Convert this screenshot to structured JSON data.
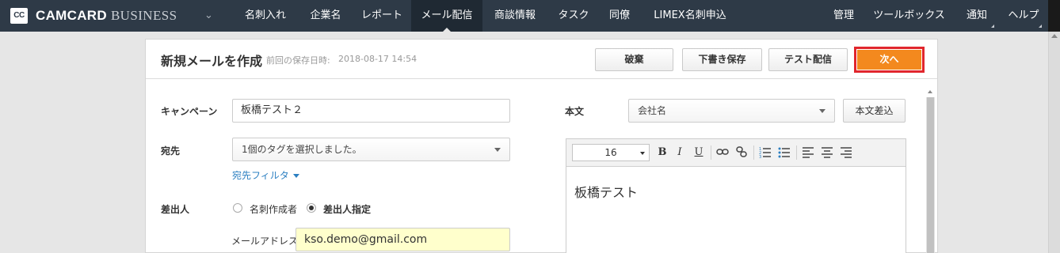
{
  "nav": {
    "logo": "CC",
    "brand": "CAMCARD",
    "brand_sub": "BUSINESS",
    "items": [
      {
        "label": "名刺入れ"
      },
      {
        "label": "企業名"
      },
      {
        "label": "レポート"
      },
      {
        "label": "メール配信",
        "active": true
      },
      {
        "label": "商談情報"
      },
      {
        "label": "タスク"
      },
      {
        "label": "同僚"
      },
      {
        "label": "LIMEX名刺申込"
      }
    ],
    "right_items": [
      {
        "label": "管理"
      },
      {
        "label": "ツールボックス"
      },
      {
        "label": "通知"
      },
      {
        "label": "ヘルプ"
      }
    ]
  },
  "header": {
    "title": "新規メールを作成",
    "saved_label": "前回の保存日時:",
    "saved_time": "2018-08-17 14:54",
    "buttons": {
      "discard": "破棄",
      "draft": "下書き保存",
      "test": "テスト配信",
      "next": "次へ"
    }
  },
  "form": {
    "campaign_label": "キャンペーン",
    "campaign_value": "板橋テスト２",
    "recipient_label": "宛先",
    "recipient_value": "1個のタグを選択しました。",
    "recipient_filter": "宛先フィルタ",
    "sender_label": "差出人",
    "sender_options": [
      {
        "label": "名刺作成者",
        "checked": false
      },
      {
        "label": "差出人指定",
        "checked": true
      }
    ],
    "email_label": "メールアドレス",
    "email_value": "kso.demo@gmail.com"
  },
  "body": {
    "label": "本文",
    "field_select": "会社名",
    "insert_button": "本文差込",
    "font_size": "16",
    "content": "板橋テスト"
  },
  "colors": {
    "nav_bg": "#2e3a47",
    "accent": "#f3891e",
    "highlight": "#e1262c",
    "email_bg": "#ffffcc"
  }
}
